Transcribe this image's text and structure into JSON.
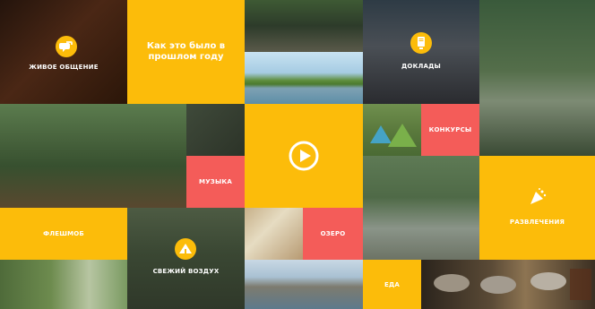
{
  "tiles": {
    "live_communication": {
      "label": "ЖИВОЕ ОБЩЕНИЕ"
    },
    "how_it_was": {
      "title_line1": "Как это было в",
      "title_line2": "прошлом году"
    },
    "reports": {
      "label": "ДОКЛАДЫ"
    },
    "contests": {
      "label": "КОНКУРСЫ"
    },
    "music": {
      "label": "МУЗЫКА"
    },
    "flashmob": {
      "label": "ФЛЕШМОБ"
    },
    "fresh_air": {
      "label": "СВЕЖИЙ ВОЗДУХ"
    },
    "lake": {
      "label": "ОЗЕРО"
    },
    "fun": {
      "label": "РАЗВЛЕЧЕНИЯ"
    },
    "food": {
      "label": "ЕДА"
    }
  },
  "colors": {
    "accent_yellow": "#fcbc0a",
    "accent_red": "#f45c59"
  },
  "icons": {
    "play": "play-icon",
    "speech": "speech-bubble-icon",
    "document": "document-icon",
    "camp": "camp-icon",
    "party": "party-icon"
  }
}
